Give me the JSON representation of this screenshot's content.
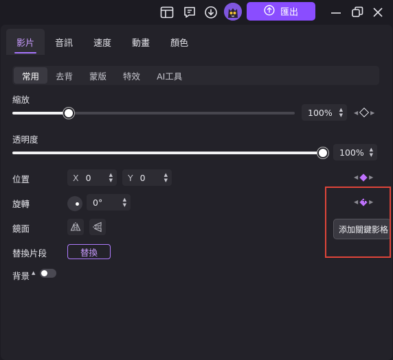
{
  "titlebar": {
    "icons": [
      "layout-icon",
      "feedback-icon",
      "download-icon",
      "avatar"
    ],
    "export_label": "匯出",
    "window_controls": [
      "minimize-icon",
      "restore-icon",
      "close-icon"
    ]
  },
  "tabs": [
    {
      "label": "影片",
      "active": true
    },
    {
      "label": "音訊",
      "active": false
    },
    {
      "label": "速度",
      "active": false
    },
    {
      "label": "動畫",
      "active": false
    },
    {
      "label": "顏色",
      "active": false
    }
  ],
  "subtabs": [
    {
      "label": "常用",
      "active": true
    },
    {
      "label": "去背",
      "active": false
    },
    {
      "label": "蒙版",
      "active": false
    },
    {
      "label": "特效",
      "active": false
    },
    {
      "label": "AI工具",
      "active": false
    }
  ],
  "scale": {
    "label": "縮放",
    "value": "100%",
    "slider_fraction": 0.2
  },
  "opacity": {
    "label": "透明度",
    "value": "100%",
    "slider_fraction": 1.0
  },
  "position": {
    "label": "位置",
    "x_label": "X",
    "x_value": "0",
    "y_label": "Y",
    "y_value": "0"
  },
  "rotation": {
    "label": "旋轉",
    "value": "0°"
  },
  "mirror": {
    "label": "鏡面"
  },
  "replace": {
    "label": "替換片段",
    "button": "替換"
  },
  "background": {
    "label": "背景",
    "toggle_on": false
  },
  "tooltip": {
    "text": "添加關鍵影格"
  },
  "colors": {
    "accent": "#8a4dff",
    "keyframe": "#c072ff",
    "highlight": "#e0453a"
  }
}
